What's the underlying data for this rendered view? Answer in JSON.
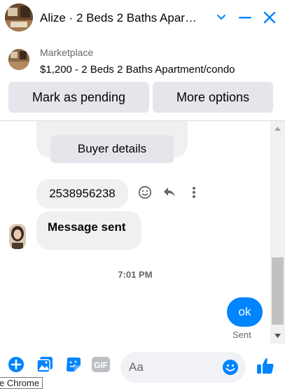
{
  "header": {
    "title": "Alize · 2 Beds 2 Baths Apar…",
    "icons": [
      "chevron-down-icon",
      "minimize-icon",
      "close-icon"
    ]
  },
  "marketplace": {
    "label": "Marketplace",
    "listing": "$1,200 - 2 Beds 2 Baths Apartment/condo"
  },
  "actions": {
    "pending": "Mark as pending",
    "more": "More options"
  },
  "messages": {
    "buyer_details": "Buyer details",
    "phone": "2538956238",
    "message_sent": "Message sent",
    "timestamp": "7:01 PM",
    "outgoing": "ok",
    "status": "Sent"
  },
  "composer": {
    "placeholder": "Aa",
    "gif_label": "GIF",
    "icons": [
      "add-icon",
      "photo-icon",
      "sticker-icon",
      "gif-icon",
      "emoji-icon",
      "thumbs-up-icon"
    ]
  },
  "tooltip": {
    "text": "e Chrome"
  },
  "colors": {
    "accent": "#0084ff",
    "bubble_gray": "#f0f0f0",
    "button_gray": "#e4e6eb"
  }
}
